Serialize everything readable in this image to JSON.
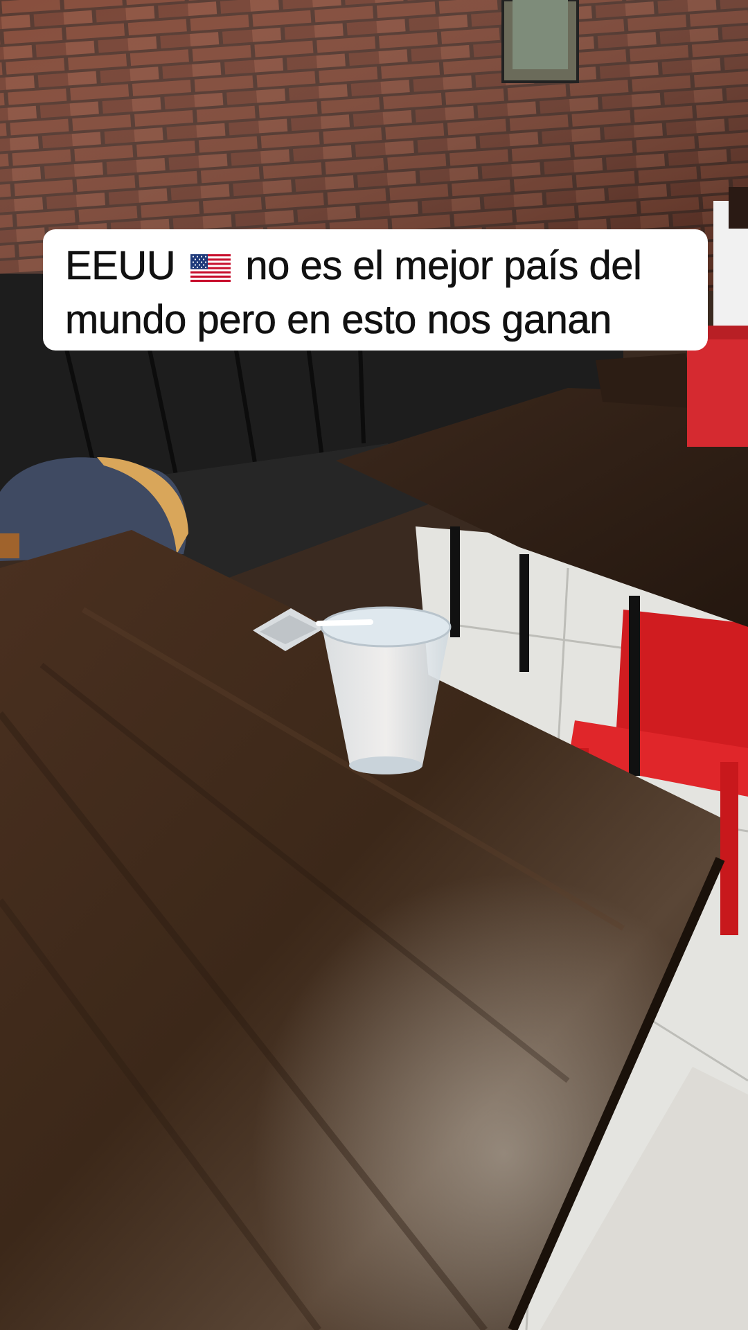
{
  "caption": {
    "line1_before_flag": "EEUU ",
    "line1_after_flag": " no es el mejor país del",
    "line2": "mundo pero en esto nos ganan",
    "flag_icon": "us-flag-icon"
  },
  "scene": {
    "description_icons": [
      "brick-wall",
      "wooden-table",
      "plastic-cup",
      "red-chair",
      "napkin-holder",
      "bench-seat",
      "backpack"
    ],
    "colors": {
      "brick": "#7a3b2a",
      "table": "#3b2619",
      "chair": "#d81e22",
      "bench": "#1e1e1e",
      "floor": "#e6e6e2"
    }
  }
}
